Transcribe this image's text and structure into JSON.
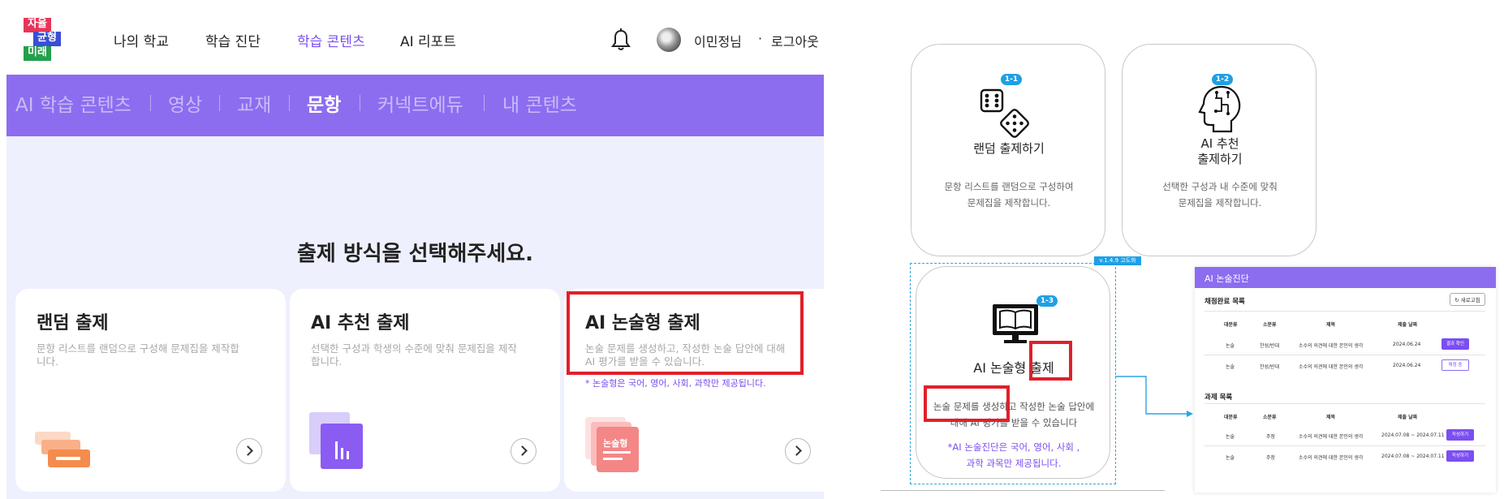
{
  "left_screen": {
    "logo": {
      "line1": "자율",
      "line2": "균형",
      "line3": "미래"
    },
    "top_nav": [
      "나의 학교",
      "학습 진단",
      "학습 콘텐츠",
      "AI 리포트"
    ],
    "user": {
      "name": "이민정님",
      "separator": "·",
      "logout": "로그아웃"
    },
    "sub_nav": [
      "AI 학습 콘텐츠",
      "영상",
      "교재",
      "문항",
      "커넥트에듀",
      "내 콘텐츠"
    ],
    "heading": "출제 방식을 선택해주세요.",
    "cards": [
      {
        "title": "랜덤 출제",
        "desc": "문항 리스트를 랜덤으로 구성해 문제집을 제작합니다."
      },
      {
        "title": "AI 추천 출제",
        "desc": "선택한 구성과 학생의 수준에 맞춰 문제집을 제작합니다."
      },
      {
        "title": "AI 논술형 출제",
        "desc": "논술 문제를 생성하고, 작성한 논술 답안에 대해 AI 평가를 받을 수 있습니다.",
        "note": "* 논술형은 국어, 영어, 사회, 과학만 제공됩니다.",
        "icon_label": "논술형"
      }
    ],
    "colors": {
      "accent": "#8c6df0",
      "active_text": "#7b4ef0",
      "highlight": "#e0202a"
    }
  },
  "right_screen": {
    "cards": [
      {
        "badge": "1-1",
        "title": "랜덤 출제하기",
        "desc": [
          "문항 리스트를 랜덤으로 구성하여",
          "문제집을 제작합니다."
        ]
      },
      {
        "badge": "1-2",
        "title": [
          "AI 추천",
          "출제하기"
        ],
        "desc": [
          "선택한 구성과 내 수준에 맞춰",
          "문제집을 제작합니다."
        ]
      },
      {
        "badge": "1-3",
        "title": "AI 논술형 출제",
        "desc": [
          "논술 문제를 생성하고 작성한 논술 답안에",
          "대해 AI 평가를 받을 수 있습니다"
        ],
        "note": [
          "*AI 논술진단은 국어, 영어, 사회 ,",
          "과학 과목만 제공됩니다."
        ]
      }
    ],
    "version_tag": "v.1.4.9 고도화",
    "preview": {
      "title": "AI 논술진단",
      "new_button": "새로고침",
      "graded": {
        "title": "채점완료 목록",
        "headers": [
          "대분류",
          "소분류",
          "제목",
          "제출 날짜"
        ],
        "rows": [
          {
            "cat": "논술",
            "sub": "찬성/반대",
            "title": "소수의 의견에 대한 본인의 생각",
            "date": "2024.06.24",
            "action": "결과 확인"
          },
          {
            "cat": "논술",
            "sub": "찬성/반대",
            "title": "소수의 의견에 대한 본인의 생각",
            "date": "2024.06.24",
            "action": "채점 중"
          }
        ]
      },
      "assignments": {
        "title": "과제 목록",
        "headers": [
          "대분류",
          "소분류",
          "제목",
          "제출 날짜"
        ],
        "rows": [
          {
            "cat": "논술",
            "sub": "주장",
            "title": "소수의 의견에 대한 본인의 생각",
            "date": "2024.07.08 ~ 2024.07.11",
            "action": "작성하기"
          },
          {
            "cat": "논술",
            "sub": "주장",
            "title": "소수의 의견에 대한 본인의 생각",
            "date": "2024.07.08 ~ 2024.07.11",
            "action": "작성하기"
          }
        ]
      }
    },
    "colors": {
      "badge": "#1ea0e6",
      "dashed_border": "#2aa6e0",
      "note": "#7b4ef0"
    }
  }
}
